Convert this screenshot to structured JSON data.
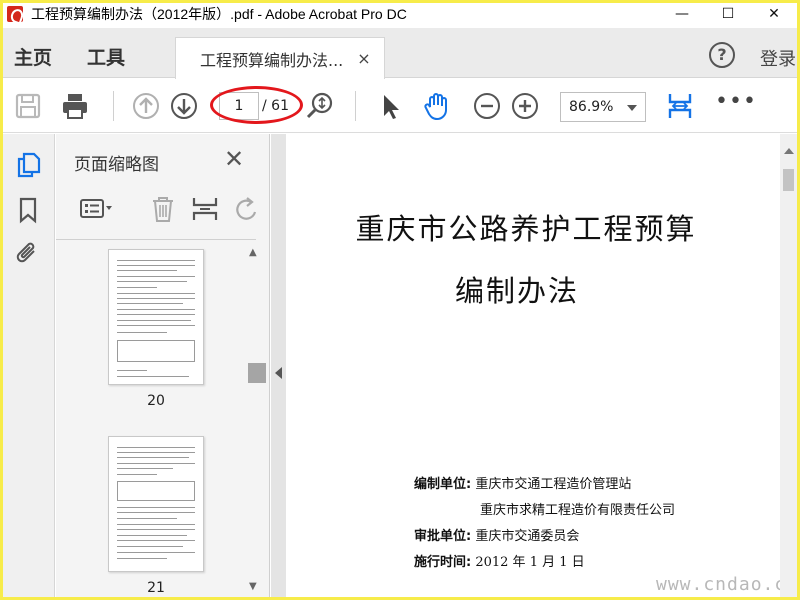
{
  "window": {
    "title": "工程预算编制办法（2012年版）.pdf - Adobe Acrobat Pro DC",
    "minimize": "—",
    "maximize": "☐",
    "close": "✕"
  },
  "tabs": {
    "home": "主页",
    "tools": "工具",
    "document_tab": "工程预算编制办法...",
    "document_tab_close": "×",
    "help": "?",
    "login": "登录"
  },
  "toolbar": {
    "page_current": "1",
    "page_total": "/ 61",
    "zoom": "86.9%",
    "more": "•••",
    "icons": [
      "save-icon",
      "print-icon",
      "prev-page-icon",
      "next-page-icon",
      "zoom-search-icon",
      "select-cursor-icon",
      "hand-tool-icon",
      "zoom-out-icon",
      "zoom-in-icon",
      "fit-width-icon",
      "more-icon"
    ],
    "annotation_color": "#e3171c"
  },
  "leftrail": {
    "icons": [
      "page-thumbnails-icon",
      "bookmark-icon",
      "attachment-icon"
    ]
  },
  "panel": {
    "title": "页面缩略图",
    "close": "✕",
    "tools": [
      "thumbnail-options-icon",
      "delete-page-icon",
      "insert-page-icon",
      "rotate-icon"
    ],
    "thumbnails": [
      {
        "page": "20"
      },
      {
        "page": "21"
      }
    ]
  },
  "document": {
    "title_line1": "重庆市公路养护工程预算",
    "title_line2": "编制办法",
    "info": [
      {
        "label": "编制单位:",
        "value": "重庆市交通工程造价管理站"
      },
      {
        "label": "",
        "value": "重庆市求精工程造价有限责任公司"
      },
      {
        "label": "审批单位:",
        "value": "重庆市交通委员会"
      },
      {
        "label": "施行时间:",
        "value": "2012 年 1 月 1 日"
      }
    ]
  },
  "watermark": "www.cndao.com",
  "colors": {
    "border_frame": "#f7ec4a",
    "accent_blue": "#1473e6",
    "acrobat_red": "#d4281c"
  }
}
